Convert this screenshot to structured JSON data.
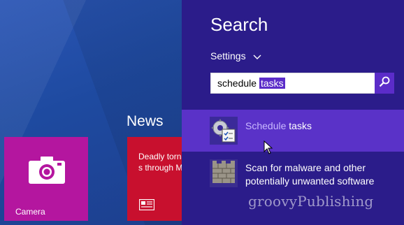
{
  "start_screen": {
    "group_label": "News",
    "tiles": [
      {
        "label": "Camera",
        "color": "#b4169f",
        "icon": "camera-icon"
      },
      {
        "label": "Deadly tornadoes s through Mi",
        "color": "#c8102e",
        "icon": "news-icon"
      }
    ]
  },
  "search_pane": {
    "title": "Search",
    "scope": {
      "label": "Settings",
      "icon": "chevron-down-icon"
    },
    "search": {
      "typed": "schedule",
      "selected": "tasks"
    },
    "search_button_icon": "search-icon",
    "results": [
      {
        "match": "Schedule",
        "rest": " tasks",
        "icon": "task-scheduler-icon",
        "highlighted": true
      },
      {
        "label": "Scan for malware and other potentially unwanted software",
        "icon": "firewall-icon"
      }
    ]
  },
  "watermark": "groovyPublishing",
  "colors": {
    "search_pane_bg": "#2b1c8a",
    "accent": "#5b2cc9",
    "start_bg": "#1e4aa0"
  }
}
